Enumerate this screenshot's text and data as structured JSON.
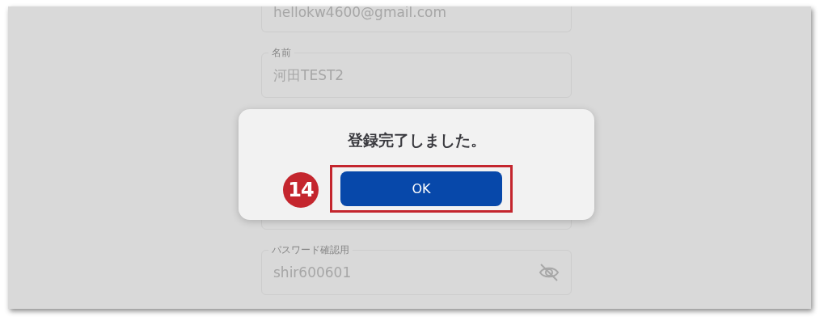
{
  "form": {
    "fields": [
      {
        "kind": "text",
        "value": "hellokw4600@gmail.com"
      },
      {
        "kind": "text",
        "label": "名前",
        "value": "河田TEST2"
      },
      {
        "kind": "covered"
      },
      {
        "kind": "password",
        "label": "パスワード確認用",
        "value": "shir600601"
      }
    ]
  },
  "dialog": {
    "message": "登録完了しました。",
    "button": "OK",
    "step_badge": "14"
  }
}
